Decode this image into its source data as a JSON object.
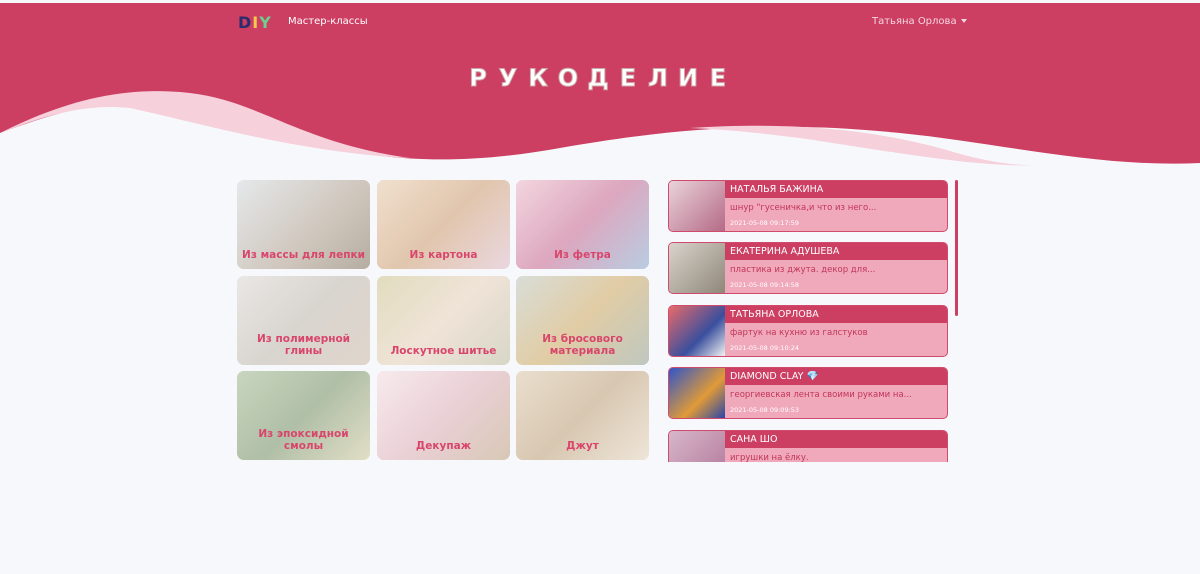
{
  "navbar": {
    "logo_parts": [
      "D",
      "I",
      "Y"
    ],
    "menu_link": "Мастер-классы",
    "user_name": "Татьяна Орлова"
  },
  "hero": {
    "title_letters": [
      "Р",
      "У",
      "К",
      "О",
      "Д",
      "Е",
      "Л",
      "И",
      "Е"
    ]
  },
  "colors": {
    "brand": "#cc3f62",
    "brand_light": "#f5d6df",
    "card_bg": "#f0a8bb",
    "page_bg": "#f7f8fb"
  },
  "categories": [
    {
      "label": "Из массы для лепки",
      "icon": "clay-flowers-photo"
    },
    {
      "label": "Из картона",
      "icon": "cardboard-photo"
    },
    {
      "label": "Из фетра",
      "icon": "felt-flowers-photo"
    },
    {
      "label": "Из полимерной глины",
      "icon": "polymer-clay-photo"
    },
    {
      "label": "Лоскутное шитье",
      "icon": "patchwork-photo"
    },
    {
      "label": "Из бросового материала",
      "icon": "waste-material-photo"
    },
    {
      "label": "Из эпоксидной смолы",
      "icon": "epoxy-resin-photo"
    },
    {
      "label": "Декупаж",
      "icon": "decoupage-photo"
    },
    {
      "label": "Джут",
      "icon": "jute-photo"
    }
  ],
  "feed": [
    {
      "author": "НАТАЛЬЯ БАЖИНА",
      "text": "шнур \"гусеничка,и что из него...",
      "time": "2021-05-08 09:17:59"
    },
    {
      "author": "ЕКАТЕРИНА АДУШЕВА",
      "text": "пластика из джута. декор для...",
      "time": "2021-05-08 09:14:58"
    },
    {
      "author": "ТАТЬЯНА ОРЛОВА",
      "text": "фартук на кухню из галстуков",
      "time": "2021-05-08 09:10:24"
    },
    {
      "author": "DIAMOND CLAY 💎",
      "text": "георгиевская лента своими руками на...",
      "time": "2021-05-08 09:09:53"
    },
    {
      "author": "САНА ШО",
      "text": "игрушки на ёлку.",
      "time": ""
    }
  ]
}
